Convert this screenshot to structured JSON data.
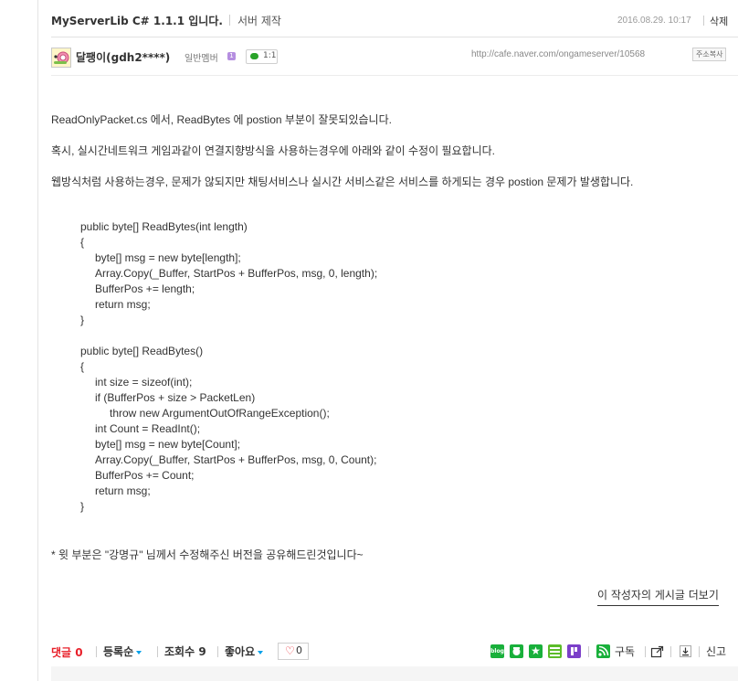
{
  "post": {
    "title": "MyServerLib C# 1.1.1 입니다.",
    "category": "서버 제작",
    "date": "2016.08.29. 10:17",
    "delete_label": "삭제",
    "url": "http://cafe.naver.com/ongameserver/10568",
    "copy_url_label": "주소복사"
  },
  "author": {
    "name": "달팽이(gdh2****)",
    "level": "일반멤버",
    "level_badge": "1",
    "chat_label": "1:1"
  },
  "content": {
    "paragraphs": [
      "ReadOnlyPacket.cs 에서, ReadBytes 에 postion 부분이 잘못되있습니다.",
      "혹시, 실시간네트워크 게임과같이 연결지향방식을 사용하는경우에 아래와 같이 수정이 필요합니다.",
      "웹방식처럼 사용하는경우, 문제가 않되지만 채팅서비스나 실시간 서비스같은 서비스를 하게되는 경우 postion 문제가 발생합니다."
    ],
    "code_lines": [
      "public byte[] ReadBytes(int length)",
      "{",
      "byte[] msg = new byte[length];",
      "Array.Copy(_Buffer, StartPos + BufferPos, msg, 0, length);",
      "BufferPos += length;",
      "return msg;",
      "}",
      "public byte[] ReadBytes()",
      "{",
      "int size = sizeof(int);",
      "if (BufferPos + size > PacketLen)",
      "throw new ArgumentOutOfRangeException();",
      "int Count = ReadInt();",
      "byte[] msg = new byte[Count];",
      "Array.Copy(_Buffer, StartPos + BufferPos, msg, 0, Count);",
      "BufferPos += Count;",
      "return msg;",
      "}"
    ],
    "footnote": "* 윗 부분은 \"강명규\" 님께서 수정해주신 버전을 공유해드린것입니다~"
  },
  "more_posts_label": "이 작성자의 게시글 더보기",
  "bottom": {
    "comments_label": "댓글",
    "comments_count": "0",
    "sort_label": "등록순",
    "views_label": "조회수",
    "views_count": "9",
    "like_label": "좋아요",
    "like_count": "0",
    "subscribe_label": "구독",
    "report_label": "신고",
    "share_icons": [
      "blog-share-icon",
      "cafe-share-icon",
      "bookmark-share-icon",
      "memo-share-icon",
      "band-share-icon"
    ],
    "colors": {
      "comments": "#e8202a",
      "share_green": "#19b03b",
      "caret": "#00a0e9"
    }
  }
}
